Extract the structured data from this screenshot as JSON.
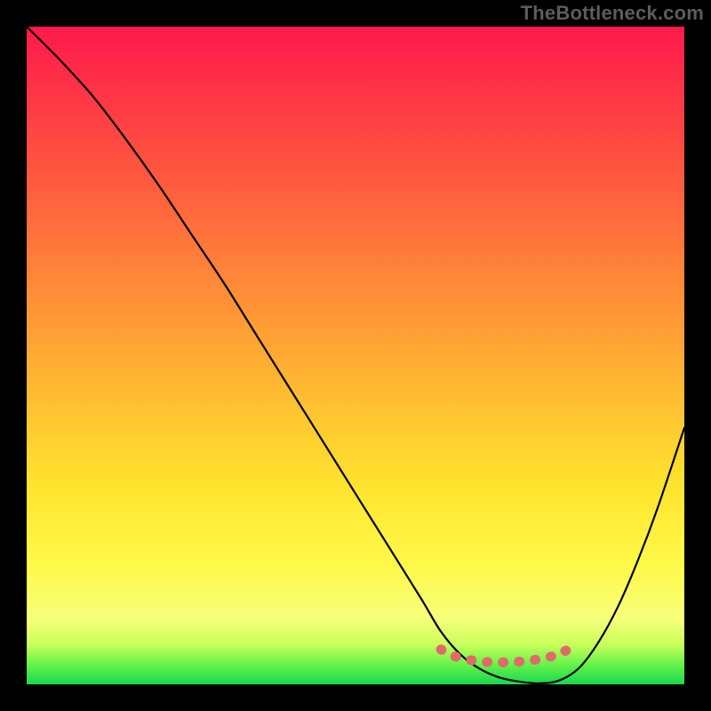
{
  "watermark": "TheBottleneck.com",
  "chart_data": {
    "type": "line",
    "title": "",
    "xlabel": "",
    "ylabel": "",
    "xlim": [
      0,
      100
    ],
    "ylim": [
      0,
      100
    ],
    "series": [
      {
        "name": "bottleneck-curve",
        "x": [
          0,
          5,
          10,
          15,
          20,
          25,
          30,
          35,
          40,
          45,
          50,
          55,
          60,
          63,
          66,
          69,
          72,
          75,
          78,
          81,
          84,
          87,
          90,
          93,
          96,
          100
        ],
        "y": [
          100,
          95,
          89.5,
          83,
          76,
          68.5,
          61,
          53,
          45,
          37,
          29,
          21,
          13,
          8,
          4.5,
          2.3,
          1.0,
          0.4,
          0.15,
          0.6,
          2.5,
          6.5,
          12,
          19,
          27,
          39
        ]
      },
      {
        "name": "optimal-zone-marker",
        "x": [
          63,
          64.5,
          66,
          68,
          70,
          72,
          74,
          76,
          78,
          80,
          81.5,
          83
        ],
        "y": [
          5.3,
          4.5,
          4.0,
          3.6,
          3.4,
          3.35,
          3.4,
          3.55,
          3.85,
          4.3,
          4.9,
          5.6
        ]
      }
    ]
  }
}
